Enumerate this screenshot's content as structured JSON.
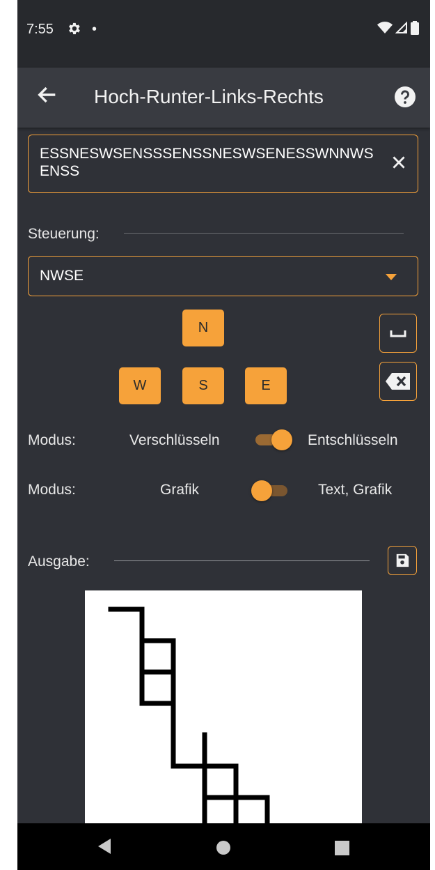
{
  "status_bar": {
    "time": "7:55",
    "icons": [
      "gear-icon",
      "notification-dot-icon",
      "wifi-icon",
      "signal-icon",
      "battery-icon"
    ]
  },
  "app_bar": {
    "title": "Hoch-Runter-Links-Rechts",
    "back_icon": "arrow-left-icon",
    "help_icon": "help-circle-icon"
  },
  "input": {
    "value": "ESSNESWSENSSSENSSNESWSENESSWNNWSENSS",
    "clear_icon": "close-icon"
  },
  "control": {
    "label": "Steuerung:",
    "selected": "NWSE"
  },
  "keys": {
    "north": "N",
    "west": "W",
    "south": "S",
    "east": "E",
    "space_icon": "space-bar-icon",
    "backspace_icon": "backspace-icon"
  },
  "mode1": {
    "label": "Modus:",
    "left": "Verschlüsseln",
    "right": "Entschlüsseln",
    "selected": "Entschlüsseln"
  },
  "mode2": {
    "label": "Modus:",
    "left": "Grafik",
    "right": "Text, Grafik",
    "selected": "Grafik"
  },
  "output": {
    "label": "Ausgabe:",
    "save_icon": "save-icon",
    "path_moves": "ESSNESWSENSSSENSSNESWSENESSWNNWSENSS"
  },
  "colors": {
    "accent": "#f6a23a",
    "background": "#2f3137",
    "appbar": "#393b41",
    "statusbar": "#27292d",
    "text": "#e8e8e8"
  },
  "nav_bar": {
    "icons": [
      "back-triangle-icon",
      "home-circle-icon",
      "recents-square-icon"
    ]
  }
}
